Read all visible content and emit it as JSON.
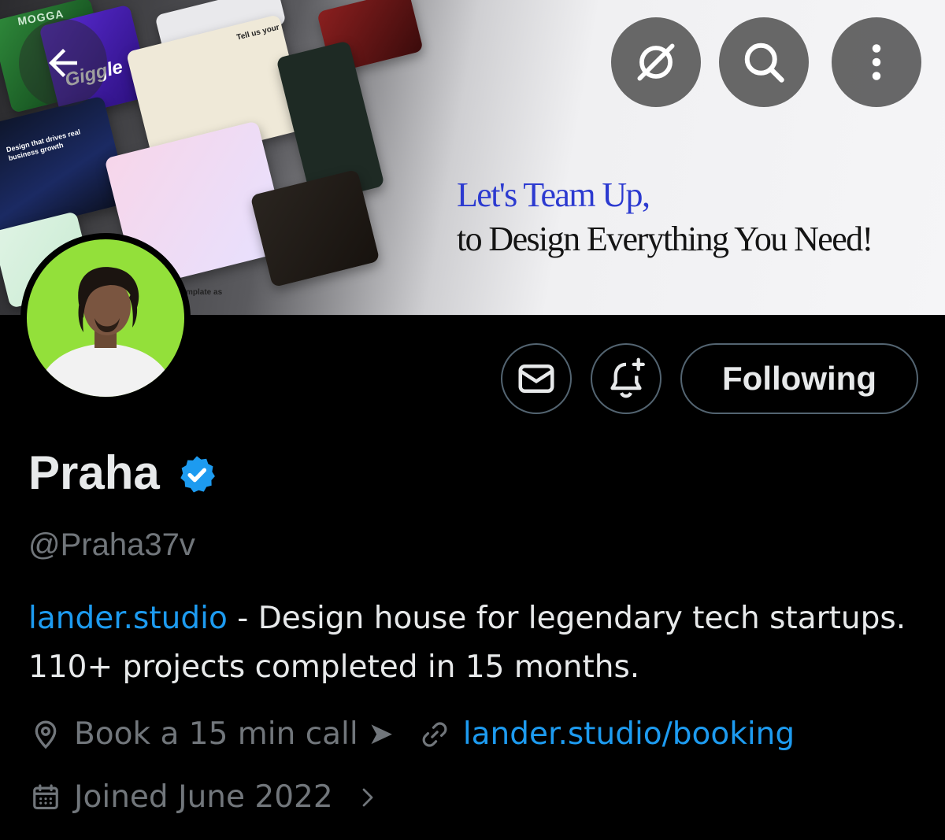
{
  "banner": {
    "tagline_line1": "Let's Team Up,",
    "tagline_line2": "to Design Everything You Need!",
    "mock_texts": {
      "logo": "MOGGA",
      "giggle": "Giggle",
      "drives": "Design that drives real business growth",
      "tell": "Tell us your",
      "template": "mplate as"
    }
  },
  "nav": {
    "back_icon": "arrow-left-icon",
    "grok_icon": "grok-icon",
    "search_icon": "search-icon",
    "more_icon": "more-vertical-icon"
  },
  "actions": {
    "message_icon": "mail-icon",
    "notify_icon": "bell-plus-icon",
    "following_label": "Following"
  },
  "profile": {
    "display_name": "Praha",
    "verified": true,
    "handle": "@Praha37v",
    "bio_link": "lander.studio",
    "bio_text": " - Design house for legendary tech startups. 110+ projects completed in 15 months.",
    "location": "Book a 15 min call ➤",
    "website": "lander.studio/booking",
    "joined": "Joined June 2022"
  },
  "colors": {
    "accent": "#1d9bf0",
    "secondary_text": "#71767b",
    "primary_text": "#e7e9ea",
    "avatar_bg": "#93e03a",
    "tagline_blue": "#2c3ad0"
  }
}
